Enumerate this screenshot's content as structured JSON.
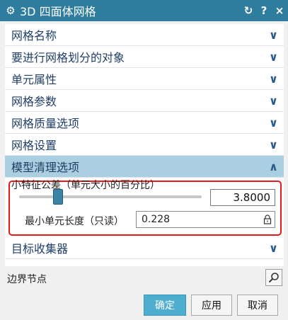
{
  "window": {
    "title": "3D 四面体网格"
  },
  "sections": [
    {
      "label": "网格名称"
    },
    {
      "label": "要进行网格划分的对象"
    },
    {
      "label": "单元属性"
    },
    {
      "label": "网格参数"
    },
    {
      "label": "网格质量选项"
    },
    {
      "label": "网格设置"
    }
  ],
  "expanded_section": {
    "label": "模型清理选项",
    "param_label": "小特征公差（单元大小的百分比）",
    "slider_value": "3.8000",
    "min_label": "最小单元长度（只读）",
    "min_value": "0.228"
  },
  "collector_section": {
    "label": "目标收集器"
  },
  "footer": {
    "label": "边界节点"
  },
  "buttons": {
    "ok": "确定",
    "apply": "应用",
    "cancel": "取消"
  },
  "colors": {
    "titlebar": "#2e7d9e",
    "expanded": "#a9cfe0",
    "highlight": "#e31b1b",
    "primary": "#4faed0"
  }
}
